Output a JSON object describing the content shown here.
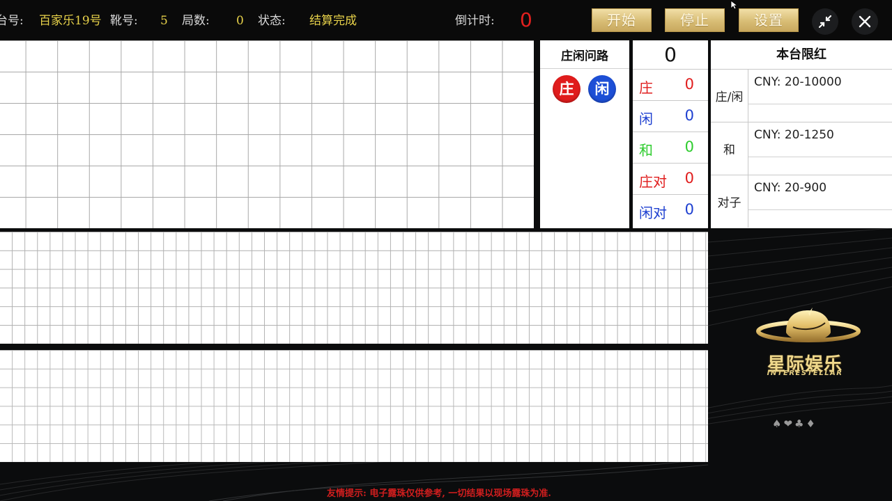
{
  "header": {
    "table_label": "台号:",
    "table_value": "百家乐19号",
    "shoe_label": "靴号:",
    "shoe_value": "5",
    "round_label": "局数:",
    "round_value": "0",
    "status_label": "状态:",
    "status_value": "结算完成",
    "countdown_label": "倒计时:",
    "countdown_value": "0"
  },
  "toolbar": {
    "start_label": "开始",
    "stop_label": "停止",
    "settings_label": "设置"
  },
  "ask_road": {
    "title": "庄闲问路",
    "banker_label": "庄",
    "player_label": "闲",
    "banker_color": "#e01c1c",
    "player_color": "#1d4fd6"
  },
  "stats": {
    "total": "0",
    "rows": [
      {
        "label": "庄",
        "value": "0",
        "color": "#e01c1c"
      },
      {
        "label": "闲",
        "value": "0",
        "color": "#1d3fd0"
      },
      {
        "label": "和",
        "value": "0",
        "color": "#2ecc2e"
      },
      {
        "label": "庄对",
        "value": "0",
        "color": "#e01c1c"
      },
      {
        "label": "闲对",
        "value": "0",
        "color": "#1d3fd0"
      }
    ]
  },
  "limits": {
    "title": "本台限红",
    "rows": [
      {
        "name": "庄/闲",
        "value": "CNY: 20-10000"
      },
      {
        "name": "和",
        "value": "CNY: 20-1250"
      },
      {
        "name": "对子",
        "value": "CNY: 20-900"
      }
    ]
  },
  "brand": {
    "name": "星际娱乐",
    "subtitle": "INTERESTELLAR",
    "suits": "♠❤♣♦"
  },
  "footer": {
    "tip": "友情提示: 电子露珠仅供参考, 一切结果以现场露珠为准."
  },
  "icons": {
    "collapse": "collapse-icon",
    "close": "close-icon"
  },
  "colors": {
    "accent_gold": "#d8bd75",
    "countdown_red": "#e0201e",
    "header_value": "#e8d24a"
  }
}
